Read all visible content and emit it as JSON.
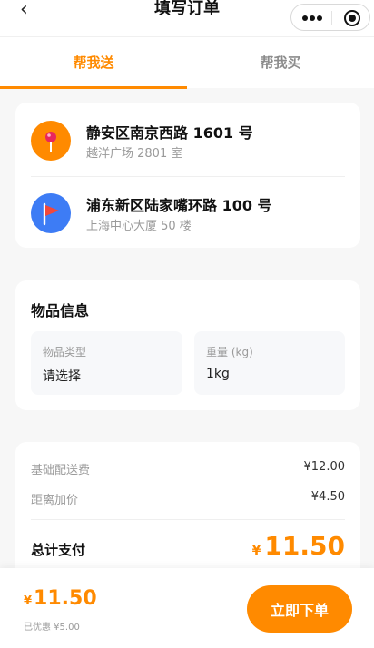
{
  "header": {
    "back_glyph": "‹",
    "title": "填写订单"
  },
  "tabs": [
    {
      "label": "帮我送",
      "active": true
    },
    {
      "label": "帮我买",
      "active": false
    }
  ],
  "addresses": [
    {
      "main": "静安区南京西路 1601 号",
      "sub": "越洋广场 2801 室",
      "icon": "pin-icon"
    },
    {
      "main": "浦东新区陆家嘴环路 100 号",
      "sub": "上海中心大厦 50 楼",
      "icon": "flag-icon"
    }
  ],
  "goods": {
    "title": "物品信息",
    "fields": [
      {
        "label": "物品类型",
        "value": "请选择"
      },
      {
        "label": "重量 (kg)",
        "value": "1kg"
      }
    ]
  },
  "price": {
    "rows": [
      {
        "label": "基础配送费",
        "value": "¥12.00"
      },
      {
        "label": "距离加价",
        "value": "¥4.50"
      }
    ],
    "total_label": "总计支付",
    "currency": "¥",
    "total": "11.50"
  },
  "bottom": {
    "currency": "¥",
    "amount": "11.50",
    "discount": "已优惠 ¥5.00",
    "submit_label": "立即下单"
  },
  "colors": {
    "accent": "#ff8a00",
    "pin_bg": "#ff8a00",
    "flag_bg": "#3d7cf5"
  }
}
